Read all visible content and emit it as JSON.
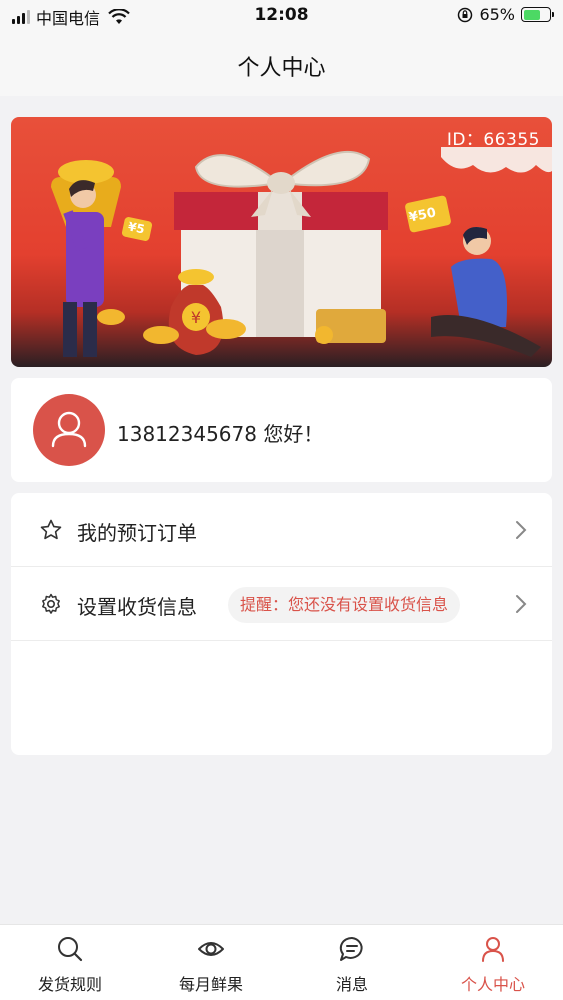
{
  "status_bar": {
    "carrier": "中国电信",
    "time": "12:08",
    "battery_percent": "65%",
    "battery_level": 0.65
  },
  "nav": {
    "title": "个人中心"
  },
  "banner": {
    "id_label": "ID：66355",
    "coin_label": "¥50",
    "coin_label_2": "¥5"
  },
  "user": {
    "greeting": "13812345678 您好！"
  },
  "menu": {
    "orders_label": "我的预订订单",
    "address_label": "设置收货信息",
    "address_reminder": "提醒：您还没有设置收货信息"
  },
  "tabs": [
    {
      "label": "发货规则",
      "icon": "search-icon"
    },
    {
      "label": "每月鲜果",
      "icon": "eye-icon"
    },
    {
      "label": "消息",
      "icon": "chat-bubble-icon"
    },
    {
      "label": "个人中心",
      "icon": "person-icon",
      "active": true
    }
  ],
  "colors": {
    "accent": "#d9534a",
    "background": "#f2f2f4"
  }
}
